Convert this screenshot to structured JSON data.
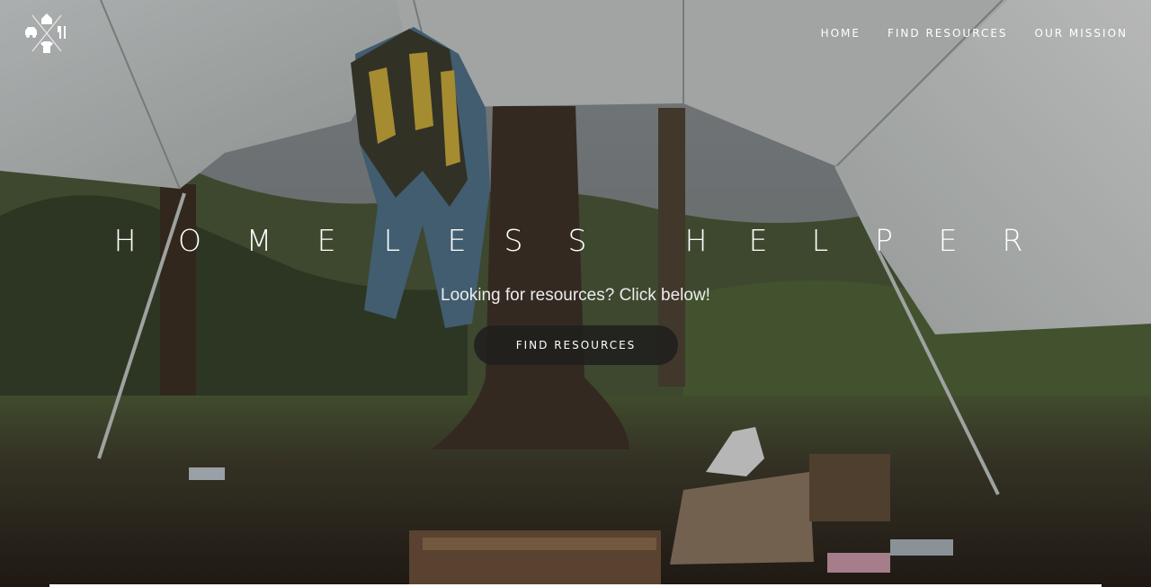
{
  "nav": {
    "logo_icon": "homeless-helper-logo-icon",
    "items": [
      {
        "label": "HOME"
      },
      {
        "label": "FIND RESOURCES"
      },
      {
        "label": "OUR MISSION"
      }
    ]
  },
  "hero": {
    "title_letters": [
      "H",
      "O",
      "M",
      "E",
      "L",
      "E",
      "S",
      "S",
      "H",
      "E",
      "L",
      "P",
      "E",
      "R"
    ],
    "subtitle": "Looking for resources? Click below!",
    "cta_label": "FIND RESOURCES"
  },
  "colors": {
    "text": "#ffffff",
    "button_bg": "#1e1e1c",
    "tarp": "#d9dcdc",
    "foliage": "#3e4a2c",
    "ground": "#3a2f24"
  }
}
